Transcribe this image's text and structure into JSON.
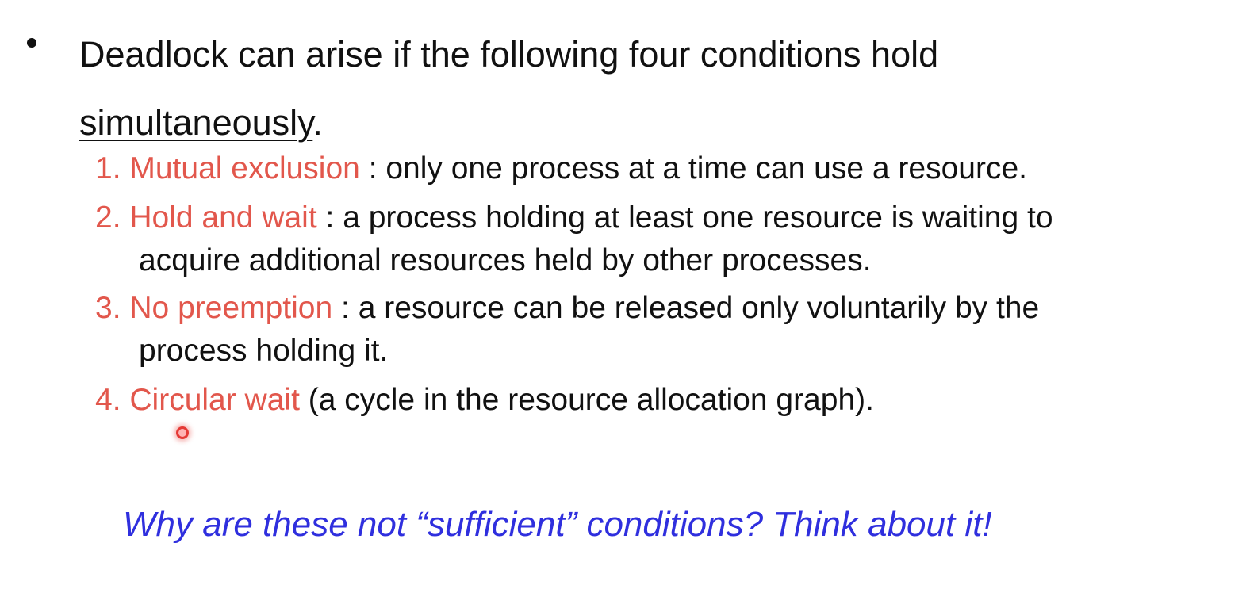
{
  "slide": {
    "bullet": {
      "text_before": "Deadlock can arise if the following four conditions hold",
      "underlined_word": "simultaneously",
      "period": "."
    },
    "conditions": [
      {
        "number": "1.",
        "term": "Mutual exclusion",
        "line1": " : only one process at a time can use a resource.",
        "line2": ""
      },
      {
        "number": "2.",
        "term": "Hold and wait",
        "line1": " : a process holding at least one resource is waiting to",
        "line2": "acquire additional resources held by other processes."
      },
      {
        "number": "3.",
        "term": "No preemption",
        "line1": " : a resource can be released only voluntarily by the",
        "line2": "process holding it."
      },
      {
        "number": "4.",
        "term": "Circular wait",
        "line1": " (a cycle in the resource allocation graph).",
        "line2": ""
      }
    ],
    "question": "Why are these not “sufficient” conditions? Think about it!",
    "colors": {
      "text": "#111111",
      "term": "#e2574c",
      "question": "#2f2fde",
      "pointer": "#e53935"
    }
  }
}
